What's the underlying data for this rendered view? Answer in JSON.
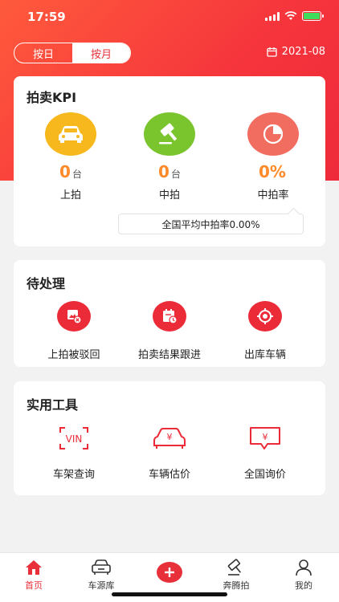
{
  "status_bar": {
    "time": "17:59"
  },
  "toggle": {
    "day_label": "按日",
    "month_label": "按月",
    "selected": "按月"
  },
  "date_picker": {
    "value": "2021-08"
  },
  "kpi": {
    "title": "拍卖KPI",
    "items": [
      {
        "value": "0",
        "unit": "台",
        "label": "上拍",
        "icon": "car-icon",
        "color": "#f7b81e"
      },
      {
        "value": "0",
        "unit": "台",
        "label": "中拍",
        "icon": "gavel-icon",
        "color": "#7ac52e"
      },
      {
        "value": "0%",
        "unit": "",
        "label": "中拍率",
        "icon": "pie-chart-icon",
        "color": "#f16d5f"
      }
    ],
    "tooltip": "全国平均中拍率0.00%"
  },
  "pending": {
    "title": "待处理",
    "items": [
      {
        "label": "上拍被驳回",
        "icon": "rejected-icon"
      },
      {
        "label": "拍卖结果跟进",
        "icon": "calendar-follow-icon"
      },
      {
        "label": "出库车辆",
        "icon": "target-icon"
      }
    ]
  },
  "tools": {
    "title": "实用工具",
    "items": [
      {
        "label": "车架查询",
        "icon": "vin-scan-icon",
        "glyph": "VIN"
      },
      {
        "label": "车辆估价",
        "icon": "car-price-icon",
        "glyph": "¥"
      },
      {
        "label": "全国询价",
        "icon": "price-inquiry-icon",
        "glyph": "¥"
      }
    ]
  },
  "tabbar": {
    "tabs": [
      {
        "label": "首页",
        "icon": "home-icon",
        "active": true
      },
      {
        "label": "车源库",
        "icon": "car-library-icon",
        "active": false
      },
      {
        "label": "",
        "icon": "plus-icon",
        "active": false
      },
      {
        "label": "奔腾拍",
        "icon": "auction-icon",
        "active": false
      },
      {
        "label": "我的",
        "icon": "user-icon",
        "active": false
      }
    ]
  },
  "colors": {
    "brand_red": "#e8303a",
    "kpi_value": "#ff8a2a"
  }
}
